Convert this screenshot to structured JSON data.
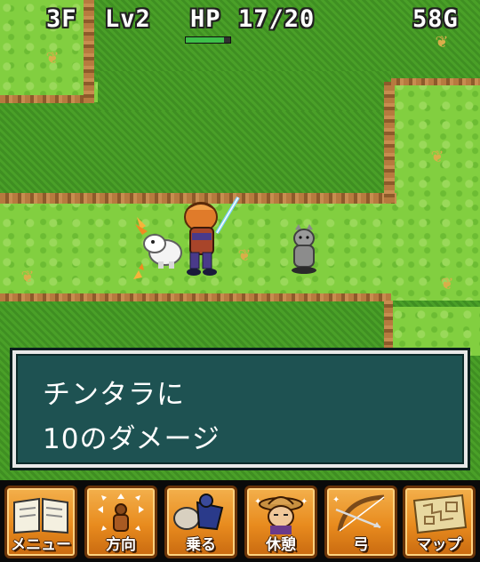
{
  "hud": {
    "floor": "3F",
    "level": "Lv2",
    "hp_label": "HP",
    "hp_value": "17/20",
    "gold": "58G",
    "hp_fraction": 0.85
  },
  "message": {
    "line1": "チンタラに",
    "line2": "10のダメージ"
  },
  "menu": {
    "items": [
      {
        "label": "メニュー",
        "icon": "book-icon"
      },
      {
        "label": "方向",
        "icon": "direction-icon"
      },
      {
        "label": "乗る",
        "icon": "ride-icon"
      },
      {
        "label": "休憩",
        "icon": "rest-icon"
      },
      {
        "label": "弓",
        "icon": "bow-icon"
      },
      {
        "label": "マップ",
        "icon": "map-icon"
      }
    ]
  },
  "colors": {
    "grass_light": "#82cf40",
    "grass_dark": "#459a26",
    "message_bg": "#1e5252",
    "menu_button": "#e88b1e"
  }
}
